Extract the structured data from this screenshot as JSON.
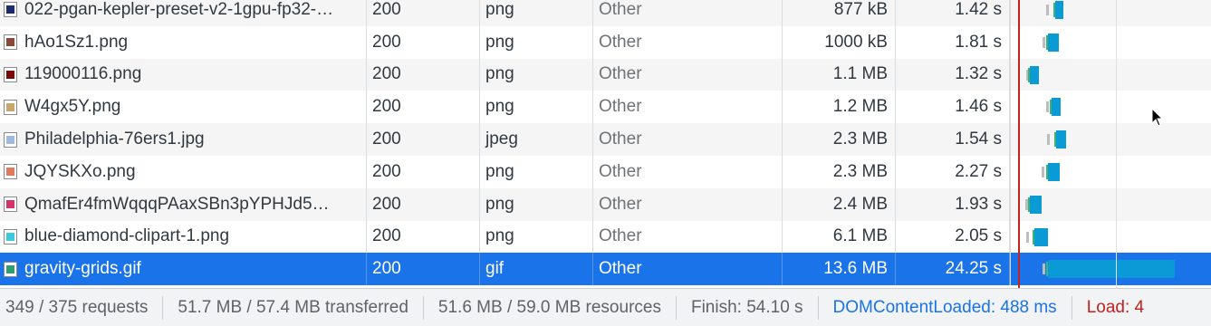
{
  "rows": [
    {
      "name": "022-pgan-kepler-preset-v2-1gpu-fp32-…",
      "status": "200",
      "type": "png",
      "initiator": "Other",
      "size": "877 kB",
      "time": "1.42 s",
      "thumb_color": "#1c2a6e"
    },
    {
      "name": "hAo1Sz1.png",
      "status": "200",
      "type": "png",
      "initiator": "Other",
      "size": "1000 kB",
      "time": "1.81 s",
      "thumb_color": "#8a4a3a"
    },
    {
      "name": "119000116.png",
      "status": "200",
      "type": "png",
      "initiator": "Other",
      "size": "1.1 MB",
      "time": "1.32 s",
      "thumb_color": "#7a0a0a"
    },
    {
      "name": "W4gx5Y.png",
      "status": "200",
      "type": "png",
      "initiator": "Other",
      "size": "1.2 MB",
      "time": "1.46 s",
      "thumb_color": "#c9a66b"
    },
    {
      "name": "Philadelphia-76ers1.jpg",
      "status": "200",
      "type": "jpeg",
      "initiator": "Other",
      "size": "2.3 MB",
      "time": "1.54 s",
      "thumb_color": "#9fb8e0"
    },
    {
      "name": "JQYSKXo.png",
      "status": "200",
      "type": "png",
      "initiator": "Other",
      "size": "2.3 MB",
      "time": "2.27 s",
      "thumb_color": "#e07a5f"
    },
    {
      "name": "QmafEr4fmWqqqPAaxSBn3pYPHJd5…",
      "status": "200",
      "type": "png",
      "initiator": "Other",
      "size": "2.4 MB",
      "time": "1.93 s",
      "thumb_color": "#d6336c"
    },
    {
      "name": "blue-diamond-clipart-1.png",
      "status": "200",
      "type": "png",
      "initiator": "Other",
      "size": "6.1 MB",
      "time": "2.05 s",
      "thumb_color": "#3bc9db"
    },
    {
      "name": "gravity-grids.gif",
      "status": "200",
      "type": "gif",
      "initiator": "Other",
      "size": "13.6 MB",
      "time": "24.25 s",
      "thumb_color": "#2f9e6e",
      "selected": true
    }
  ],
  "status_bar": {
    "requests": "349 / 375 requests",
    "transferred": "51.7 MB / 57.4 MB transferred",
    "resources": "51.6 MB / 59.0 MB resources",
    "finish": "Finish: 54.10 s",
    "dom_content_loaded": "DOMContentLoaded: 488 ms",
    "load": "Load: 4"
  },
  "colors": {
    "selected_row": "#1a73e8",
    "waterfall_bar": "#0a9bd6",
    "dom_line": "#1a73e8",
    "load_line": "#c5221f"
  }
}
